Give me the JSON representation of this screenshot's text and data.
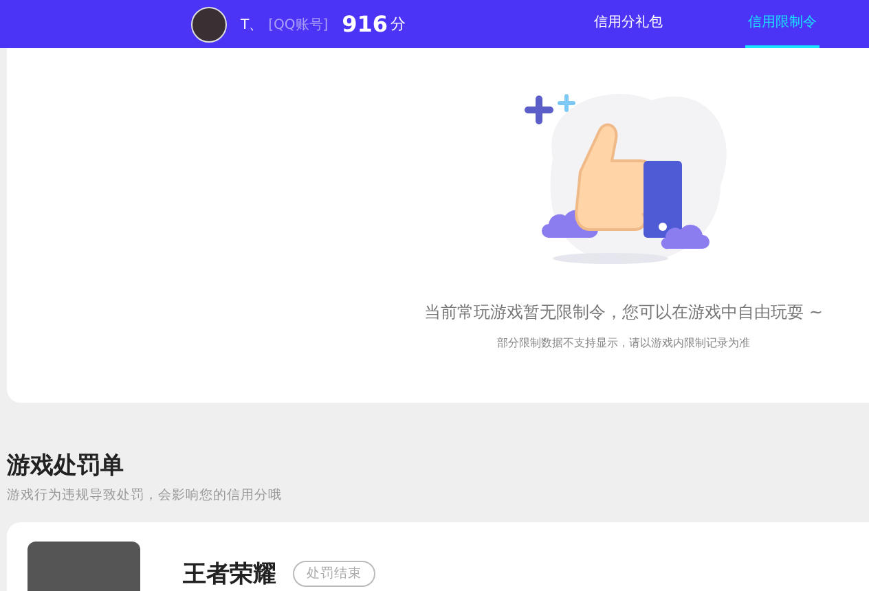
{
  "header": {
    "user_name": "T、",
    "account_type": "[QQ账号]",
    "score": "916",
    "score_unit": "分",
    "tabs": [
      {
        "label": "信用分礼包",
        "selected": false
      },
      {
        "label": "信用限制令",
        "selected": true
      }
    ]
  },
  "restriction_panel": {
    "message": "当前常玩游戏暂无限制令，您可以在游戏中自由玩耍 ~",
    "note": "部分限制数据不支持显示，请以游戏内限制记录为准"
  },
  "penalty_section": {
    "title": "游戏处罚单",
    "subtitle": "游戏行为违规导致处罚，会影响您的信用分哦",
    "items": [
      {
        "game": "王者荣耀",
        "status": "处罚结束"
      }
    ]
  }
}
